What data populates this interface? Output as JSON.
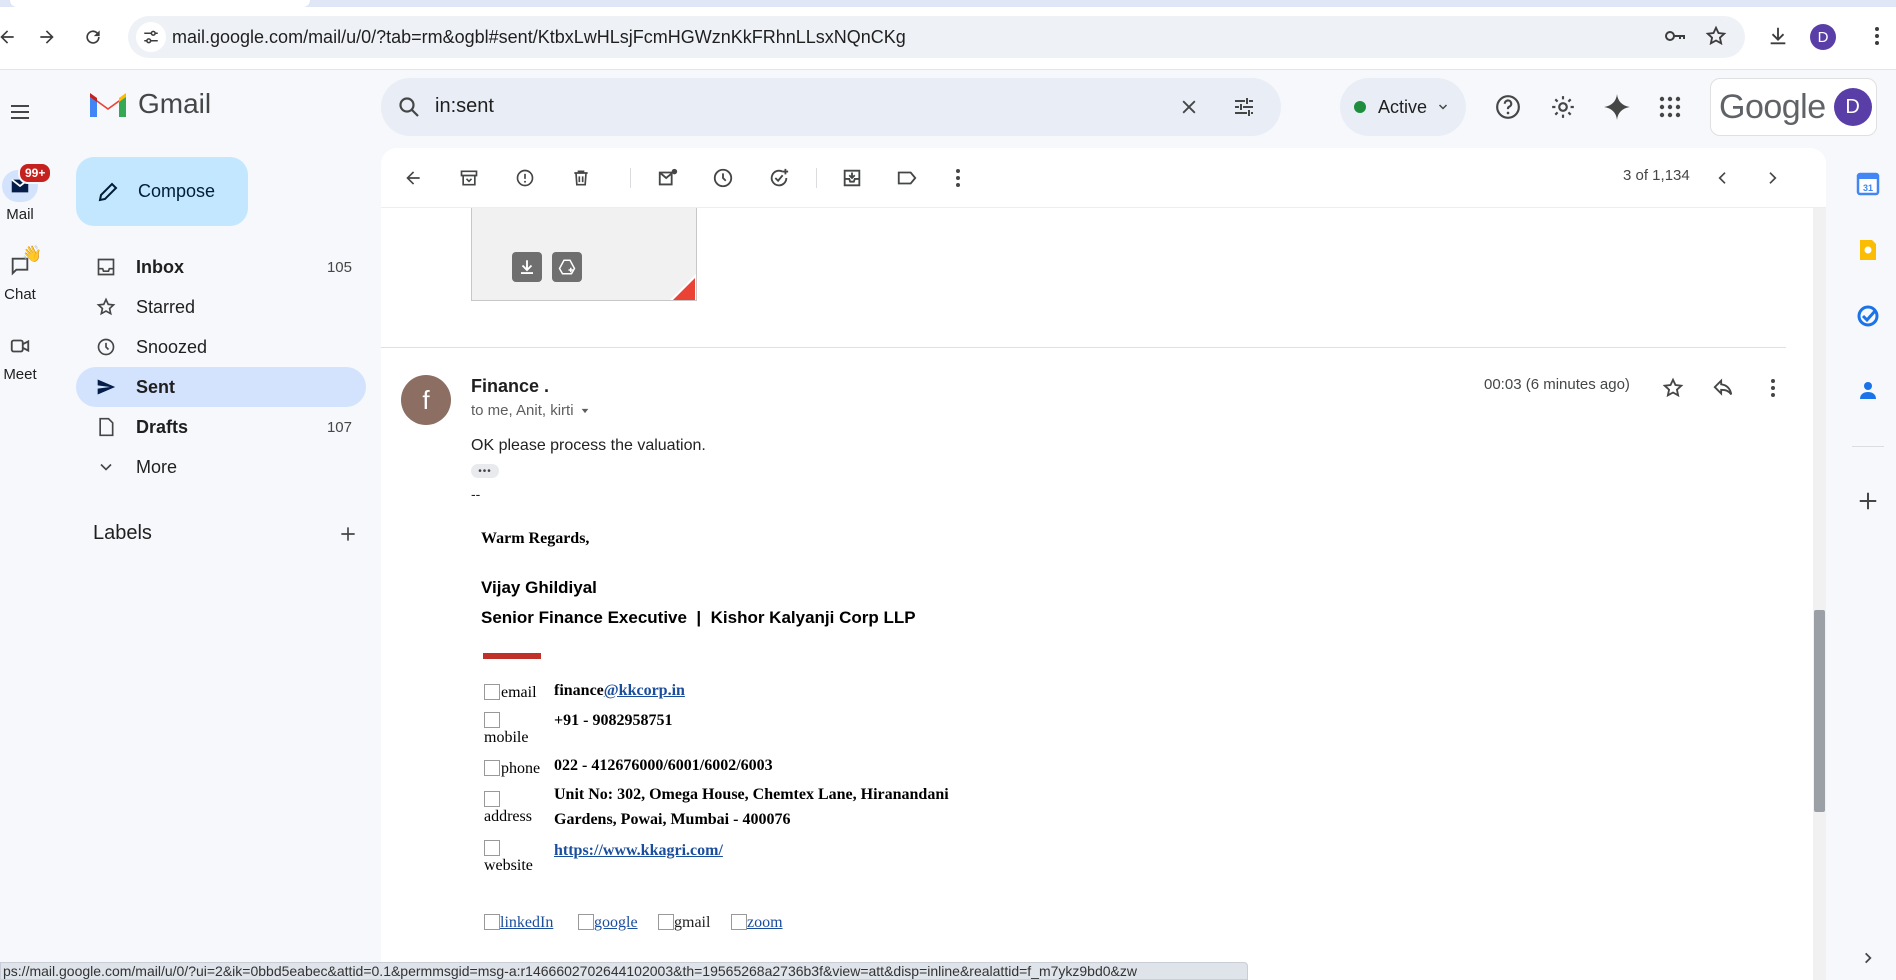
{
  "browser": {
    "url": "mail.google.com/mail/u/0/?tab=rm&ogbl#sent/KtbxLwHLsjFcmHGWznKkFRhnLLsxNQnCKg",
    "profile_initial": "D"
  },
  "rail": {
    "mail_label": "Mail",
    "mail_badge": "99+",
    "chat_label": "Chat",
    "meet_label": "Meet"
  },
  "app": {
    "name": "Gmail"
  },
  "compose": {
    "label": "Compose"
  },
  "nav": [
    {
      "label": "Inbox",
      "count": "105",
      "icon": "inbox-icon"
    },
    {
      "label": "Starred",
      "count": "",
      "icon": "star-icon"
    },
    {
      "label": "Snoozed",
      "count": "",
      "icon": "clock-icon"
    },
    {
      "label": "Sent",
      "count": "",
      "icon": "send-icon"
    },
    {
      "label": "Drafts",
      "count": "107",
      "icon": "draft-icon"
    },
    {
      "label": "More",
      "count": "",
      "icon": "chevron-down-icon"
    }
  ],
  "labels": {
    "title": "Labels"
  },
  "search": {
    "query": "in:sent"
  },
  "status": {
    "label": "Active",
    "color": "#1e8e3e"
  },
  "account": {
    "brand": "Google",
    "initial": "D"
  },
  "toolbar": {
    "pager": "3 of 1,134"
  },
  "message": {
    "sender": "Finance .",
    "avatar_initial": "f",
    "recipients": "to me, Anit, kirti",
    "time": "00:03 (6 minutes ago)",
    "body": "OK please process the valuation.",
    "sig_dash": "--",
    "signature": {
      "greeting": "Warm Regards,",
      "name": "Vijay Ghildiyal",
      "title": "Senior Finance Executive  |  Kishor Kalyanji Corp LLP",
      "email_alt": "email",
      "email_prefix": "finance",
      "email_domain": "@kkcorp.in",
      "mobile_alt": "mobile",
      "mobile": "+91 - 9082958751",
      "phone_alt": "phone",
      "phone": "022 - 412676000/6001/6002/6003",
      "address_alt": "address",
      "address_line1": "Unit No: 302, Omega House, Chemtex Lane, Hiranandani",
      "address_line2": "Gardens, Powai, Mumbai - 400076",
      "website_alt": "website",
      "website": "https://www.kkagri.com/",
      "social": [
        "linkedIn",
        "google",
        "gmail",
        "zoom"
      ]
    }
  },
  "status_bar": {
    "url": "ps://mail.google.com/mail/u/0/?ui=2&ik=0bbd5eabec&attid=0.1&permmsgid=msg-a:r1466602702644102003&th=19565268a2736b3f&view=att&disp=inline&realattid=f_m7ykz9bd0&zw"
  },
  "colors": {
    "accent": "#0b57d0",
    "compose_bg": "#c2e7ff",
    "selected_nav": "#d3e3fd",
    "gmail_red": "#ea4335"
  }
}
